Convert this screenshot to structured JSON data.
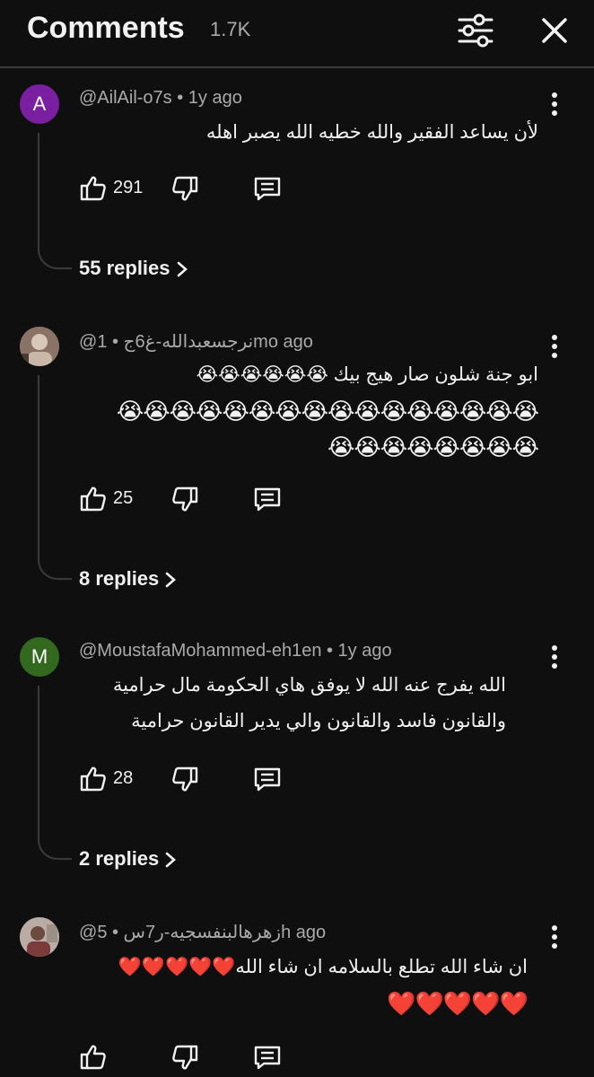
{
  "header": {
    "title": "Comments",
    "count": "1.7K",
    "filter_icon": "sliders-icon",
    "close_icon": "close-icon"
  },
  "comments": [
    {
      "avatar_letter": "A",
      "avatar_color": "#7b1fa2",
      "meta": "@AilAil-o7s • 1y ago",
      "lines": [
        "لأن يساعد الفقير والله خطيه الله يصبر اهله"
      ],
      "likes": "291",
      "replies": "55 replies"
    },
    {
      "avatar_letter": "",
      "avatar_color": "#6d5a4a",
      "meta": "@نرجسعبدالله-غ6ج • 1mo ago",
      "lines": [
        "ابو جنة شلون  صار هيج بيك 😭😭😭😭😭😭",
        "😭😭😭😭😭😭😭😭😭😭😭😭😭😭😭😭",
        "😭😭😭😭😭😭😭😭"
      ],
      "likes": "25",
      "replies": "8 replies"
    },
    {
      "avatar_letter": "M",
      "avatar_color": "#33691e",
      "meta": "@MoustafaMohammed-eh1en • 1y ago",
      "lines": [
        "الله يفرج عنه الله لا يوفق هاي الحكومة مال حرامية",
        "والقانون فاسد والقانون والي يدير القانون حرامية"
      ],
      "likes": "28",
      "replies": "2 replies"
    },
    {
      "avatar_letter": "",
      "avatar_color": "#8a7f7a",
      "meta": "@زهرهالبنفسجيه-ر7س • 5h ago",
      "lines": [
        "ان شاء الله تطلع بالسلامه ان شاء الله❤️❤️❤️❤️❤️",
        "❤️❤️❤️❤️❤️"
      ],
      "likes": "",
      "replies": ""
    }
  ]
}
